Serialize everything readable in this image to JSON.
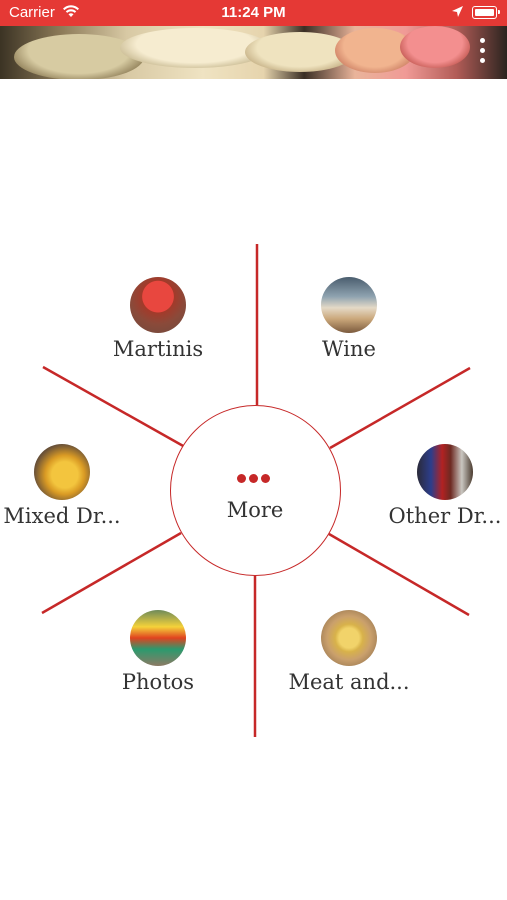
{
  "status_bar": {
    "carrier": "Carrier",
    "time": "11:24 PM",
    "icons": [
      "wifi-icon",
      "location-arrow-icon",
      "battery-icon"
    ]
  },
  "header": {
    "banner_image": "martini-glasses-banner",
    "menu_icon": "vertical-dots-menu-icon"
  },
  "radial_menu": {
    "center": {
      "label": "More",
      "icon": "three-dots-icon"
    },
    "items": [
      {
        "label": "Martinis",
        "thumbnail": "martini-photo"
      },
      {
        "label": "Wine",
        "thumbnail": "wine-glasses-photo"
      },
      {
        "label": "Mixed Dr...",
        "thumbnail": "mixed-drink-photo"
      },
      {
        "label": "Other Dr...",
        "thumbnail": "beer-bottles-photo"
      },
      {
        "label": "Photos",
        "thumbnail": "tropical-cocktail-photo"
      },
      {
        "label": "Meat and...",
        "thumbnail": "cheese-plate-photo"
      }
    ]
  },
  "colors": {
    "accent": "#c62828",
    "status_bar": "#e53935",
    "text": "#333333",
    "background": "#ffffff"
  }
}
